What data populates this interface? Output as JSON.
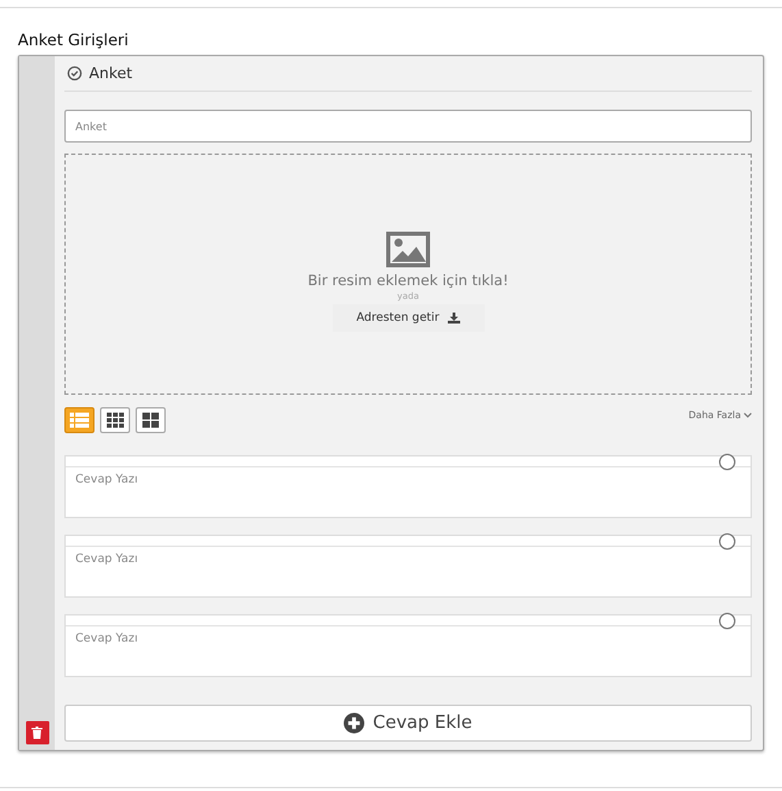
{
  "section_title": "Anket Girişleri",
  "panel": {
    "title": "Anket",
    "input": {
      "placeholder": "Anket"
    },
    "upload": {
      "text": "Bir resim eklemek için tıkla!",
      "separator": "yada",
      "button": "Adresten getir"
    },
    "views": [
      {
        "kind": "list",
        "selected": true
      },
      {
        "kind": "grid",
        "selected": false
      },
      {
        "kind": "tiles",
        "selected": false
      }
    ],
    "more": "Daha Fazla",
    "answers": [
      {
        "placeholder": "Cevap Yazı",
        "selected": false
      },
      {
        "placeholder": "Cevap Yazı",
        "selected": false
      },
      {
        "placeholder": "Cevap Yazı",
        "selected": false
      }
    ],
    "add_button": "Cevap Ekle"
  }
}
